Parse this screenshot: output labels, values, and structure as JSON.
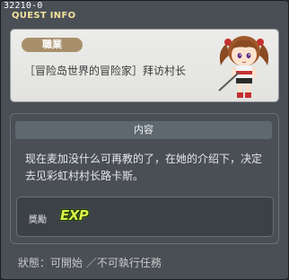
{
  "title_bar": {
    "quest_id": "32210-0",
    "window_title": "QUEST INFO"
  },
  "info": {
    "job_tag": "職業",
    "quest_name": "［冒险岛世界的冒险家］拜访村长"
  },
  "content": {
    "header": "内容",
    "text": "现在麦加没什么可再教的了，在她的介绍下，决定去见彩虹村村长路卡斯。"
  },
  "reward": {
    "label": "獎勵",
    "exp_icon": "EXP"
  },
  "status": {
    "text": "狀態：可開始 ／不可執行任務"
  },
  "colors": {
    "title_text": "#f2e29c",
    "job_tag_bg": "#a88f6c",
    "window_bg": "#4a4f56",
    "exp_text": "#d9f24a"
  },
  "npc_icon": "girl-npc-portrait-icon"
}
